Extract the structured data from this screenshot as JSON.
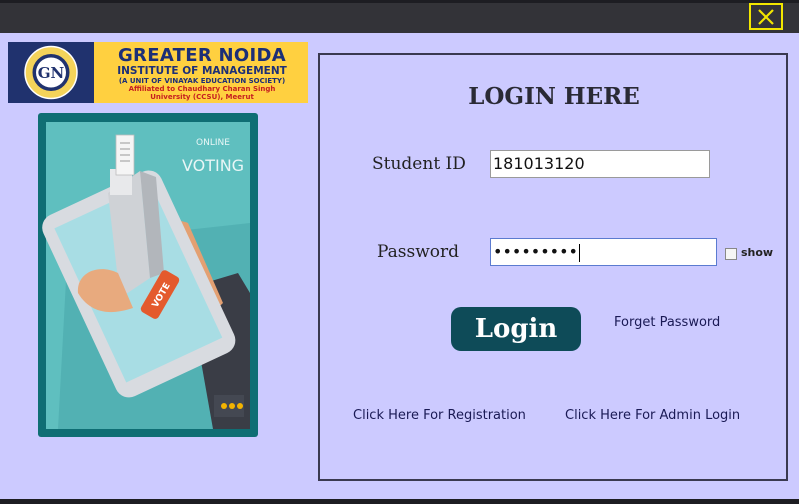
{
  "window": {
    "close_icon": "close-x-icon",
    "close_border_color": "#f2e600"
  },
  "logo": {
    "name": "GREATER NOIDA",
    "subtitle": "INSTITUTE OF MANAGEMENT",
    "society": "(A UNIT OF VINAYAK EDUCATION SOCIETY)",
    "affiliation_line1": "Affiliated to Chaudhary Charan Singh",
    "affiliation_line2": "University (CCSU), Meerut",
    "seal_letters": "GN"
  },
  "illustration": {
    "title_line1": "ONLINE",
    "title_line2": "VOTING",
    "badge": "VOTE"
  },
  "form": {
    "heading": "LOGIN HERE",
    "student_id_label": "Student ID",
    "student_id_value": "181013120",
    "password_label": "Password",
    "password_value": "•••••••••",
    "show_label": "show",
    "login_button": "Login",
    "forget_password": "Forget Password",
    "registration_link": "Click Here For Registration",
    "admin_login_link": "Click Here For Admin Login",
    "button_color": "#0e4b58",
    "background_color": "#cccaff"
  }
}
